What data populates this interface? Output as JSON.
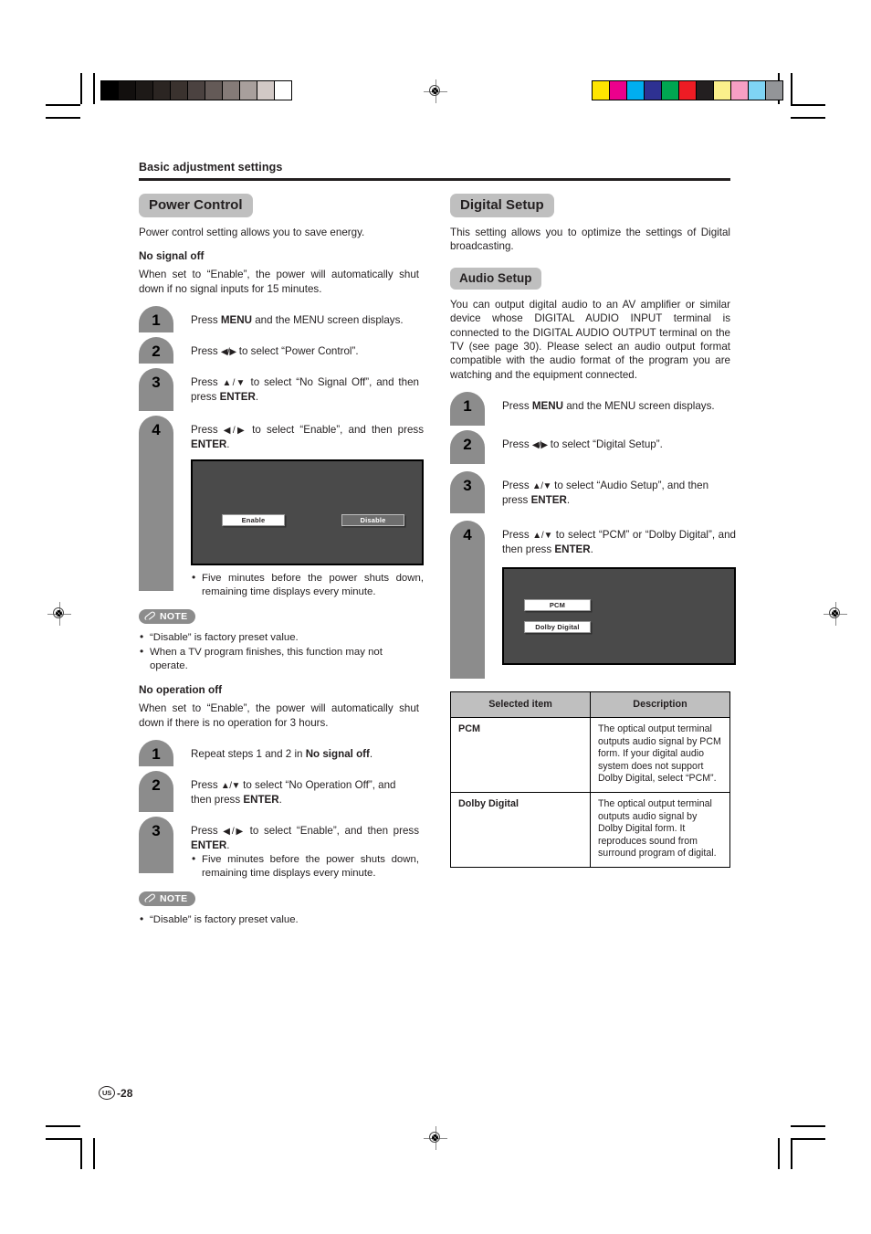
{
  "print_marks": {
    "gray_swatches": [
      "#000000",
      "#120f0e",
      "#1d1917",
      "#2b2522",
      "#3a322e",
      "#4b4240",
      "#645a57",
      "#857b78",
      "#a89f9c",
      "#d2c9c6",
      "#ffffff"
    ],
    "color_swatches": [
      "#ffe500",
      "#ec008c",
      "#00aeef",
      "#2e3192",
      "#00a651",
      "#ed1c24",
      "#231f20",
      "#fbef8b",
      "#f79fc4",
      "#7fd4f4",
      "#939598"
    ],
    "registration_icon": "registration-target-icon"
  },
  "header": {
    "running_head": "Basic adjustment settings"
  },
  "left_column": {
    "section_title": "Power Control",
    "intro": "Power control setting allows you to save energy.",
    "no_signal": {
      "subhead": "No signal off",
      "description": "When set to “Enable”, the power will automatically shut down if no signal inputs for 15 minutes.",
      "steps": [
        {
          "num": "1",
          "text_html": "Press <span class=\"kbd\">MENU</span> and the MENU screen displays."
        },
        {
          "num": "2",
          "text_html": "Press <span class=\"arrows\">◀/▶</span> to select “Power Control”."
        },
        {
          "num": "3",
          "text_html": "Press <span class=\"arrows\">▲/▼</span> to select “No Signal Off”, and then press <span class=\"kbd\">ENTER</span>."
        },
        {
          "num": "4",
          "text_html": "Press <span class=\"arrows\">◀/▶</span> to select “Enable”, and then press <span class=\"kbd\">ENTER</span>."
        }
      ],
      "screen": {
        "option_selected": "Enable",
        "option_unselected": "Disable"
      },
      "after_screen_bullet": "Five minutes before the power shuts down, remaining time displays every minute.",
      "note_label": "NOTE",
      "note_items": [
        "“Disable” is factory preset value.",
        "When a TV program finishes, this function may not operate."
      ]
    },
    "no_operation": {
      "subhead": "No operation off",
      "description": "When set to “Enable”, the power will automatically shut down if there is no operation for 3 hours.",
      "steps": [
        {
          "num": "1",
          "text_html": "Repeat steps 1 and 2 in <span class=\"kbd\">No signal off</span>."
        },
        {
          "num": "2",
          "text_html": "Press <span class=\"arrows\">▲/▼</span> to select “No Operation Off”, and then press <span class=\"kbd\">ENTER</span>."
        },
        {
          "num": "3",
          "text_html": "Press <span class=\"arrows\">◀/▶</span> to select “Enable”, and then press <span class=\"kbd\">ENTER</span>."
        }
      ],
      "step3_bullet": "Five minutes before the power shuts down, remaining time displays every minute.",
      "note_label": "NOTE",
      "note_items": [
        "“Disable” is factory preset value."
      ]
    }
  },
  "right_column": {
    "section_title": "Digital Setup",
    "intro": "This setting allows you to optimize the settings of Digital broadcasting.",
    "audio_setup": {
      "section_title": "Audio Setup",
      "description": "You can output digital audio to an AV amplifier or similar device whose DIGITAL AUDIO INPUT terminal is connected to the DIGITAL AUDIO OUTPUT terminal on the TV (see page 30). Please select an audio output format compatible with the audio format of the program you are watching and the equipment connected.",
      "steps": [
        {
          "num": "1",
          "text_html": "Press <span class=\"kbd\">MENU</span> and the MENU screen displays."
        },
        {
          "num": "2",
          "text_html": "Press <span class=\"arrows\">◀/▶</span> to select “Digital Setup”."
        },
        {
          "num": "3",
          "text_html": "Press <span class=\"arrows\">▲/▼</span> to select “Audio Setup”, and then press <span class=\"kbd\">ENTER</span>."
        },
        {
          "num": "4",
          "text_html": "Press <span class=\"arrows\">▲/▼</span> to select “PCM” or “Dolby Digital”, and then press <span class=\"kbd\">ENTER</span>."
        }
      ],
      "screen": {
        "option_selected": "PCM",
        "option_second": "Dolby Digital"
      },
      "table": {
        "headers": [
          "Selected item",
          "Description"
        ],
        "rows": [
          {
            "item": "PCM",
            "description": "The optical output terminal outputs audio signal by PCM form. If your digital audio system does not support Dolby Digital, select “PCM”."
          },
          {
            "item": "Dolby Digital",
            "description": "The optical output terminal outputs audio signal by Dolby Digital form. It reproduces sound from surround program of digital."
          }
        ]
      }
    }
  },
  "footer": {
    "locale": "US",
    "page_number": "-28"
  }
}
